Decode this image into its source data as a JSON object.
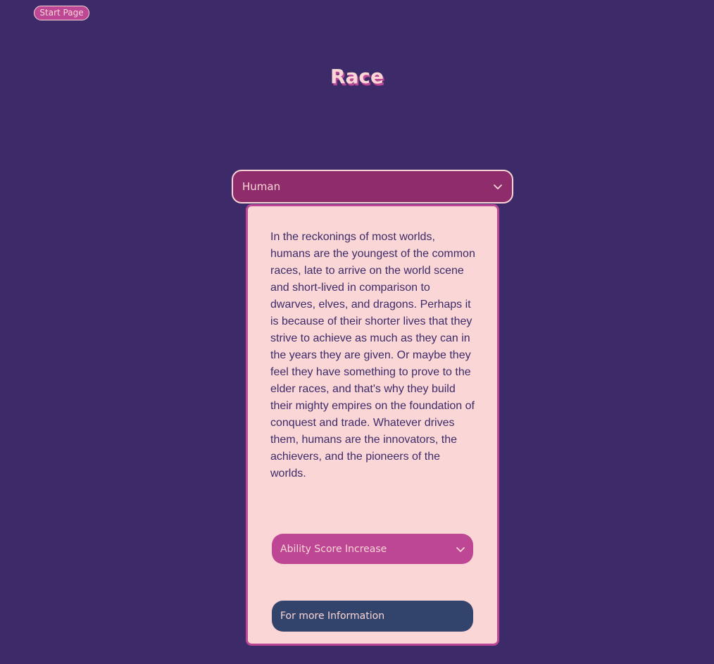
{
  "nav": {
    "start_page_label": "Start Page"
  },
  "header": {
    "title": "Race"
  },
  "race_select": {
    "selected": "Human"
  },
  "race_card": {
    "description": "In the reckonings of most worlds, humans are the youngest of the common races, late to arrive on the world scene and short-lived in comparison to dwarves, elves, and dragons. Perhaps it is because of their shorter lives that they strive to achieve as much as they can in the years they are given. Or maybe they feel they have something to prove to the elder races, and that's why they build their mighty empires on the foundation of conquest and trade. Whatever drives them, humans are the innovators, the achievers, and the pioneers of the worlds.",
    "ability_score_label": "Ability Score Increase",
    "more_info_label": "For more Information"
  },
  "icons": {
    "race_select_arrow": "chevron-down-icon",
    "ability_score_arrow": "chevron-down-icon"
  },
  "colors": {
    "background": "#3d2b69",
    "accent_pink": "#bd4795",
    "select_fill": "#8f2c6c",
    "card_fill": "#fbd6d6",
    "info_button": "#33446c",
    "text_dark": "#3d2b69"
  }
}
